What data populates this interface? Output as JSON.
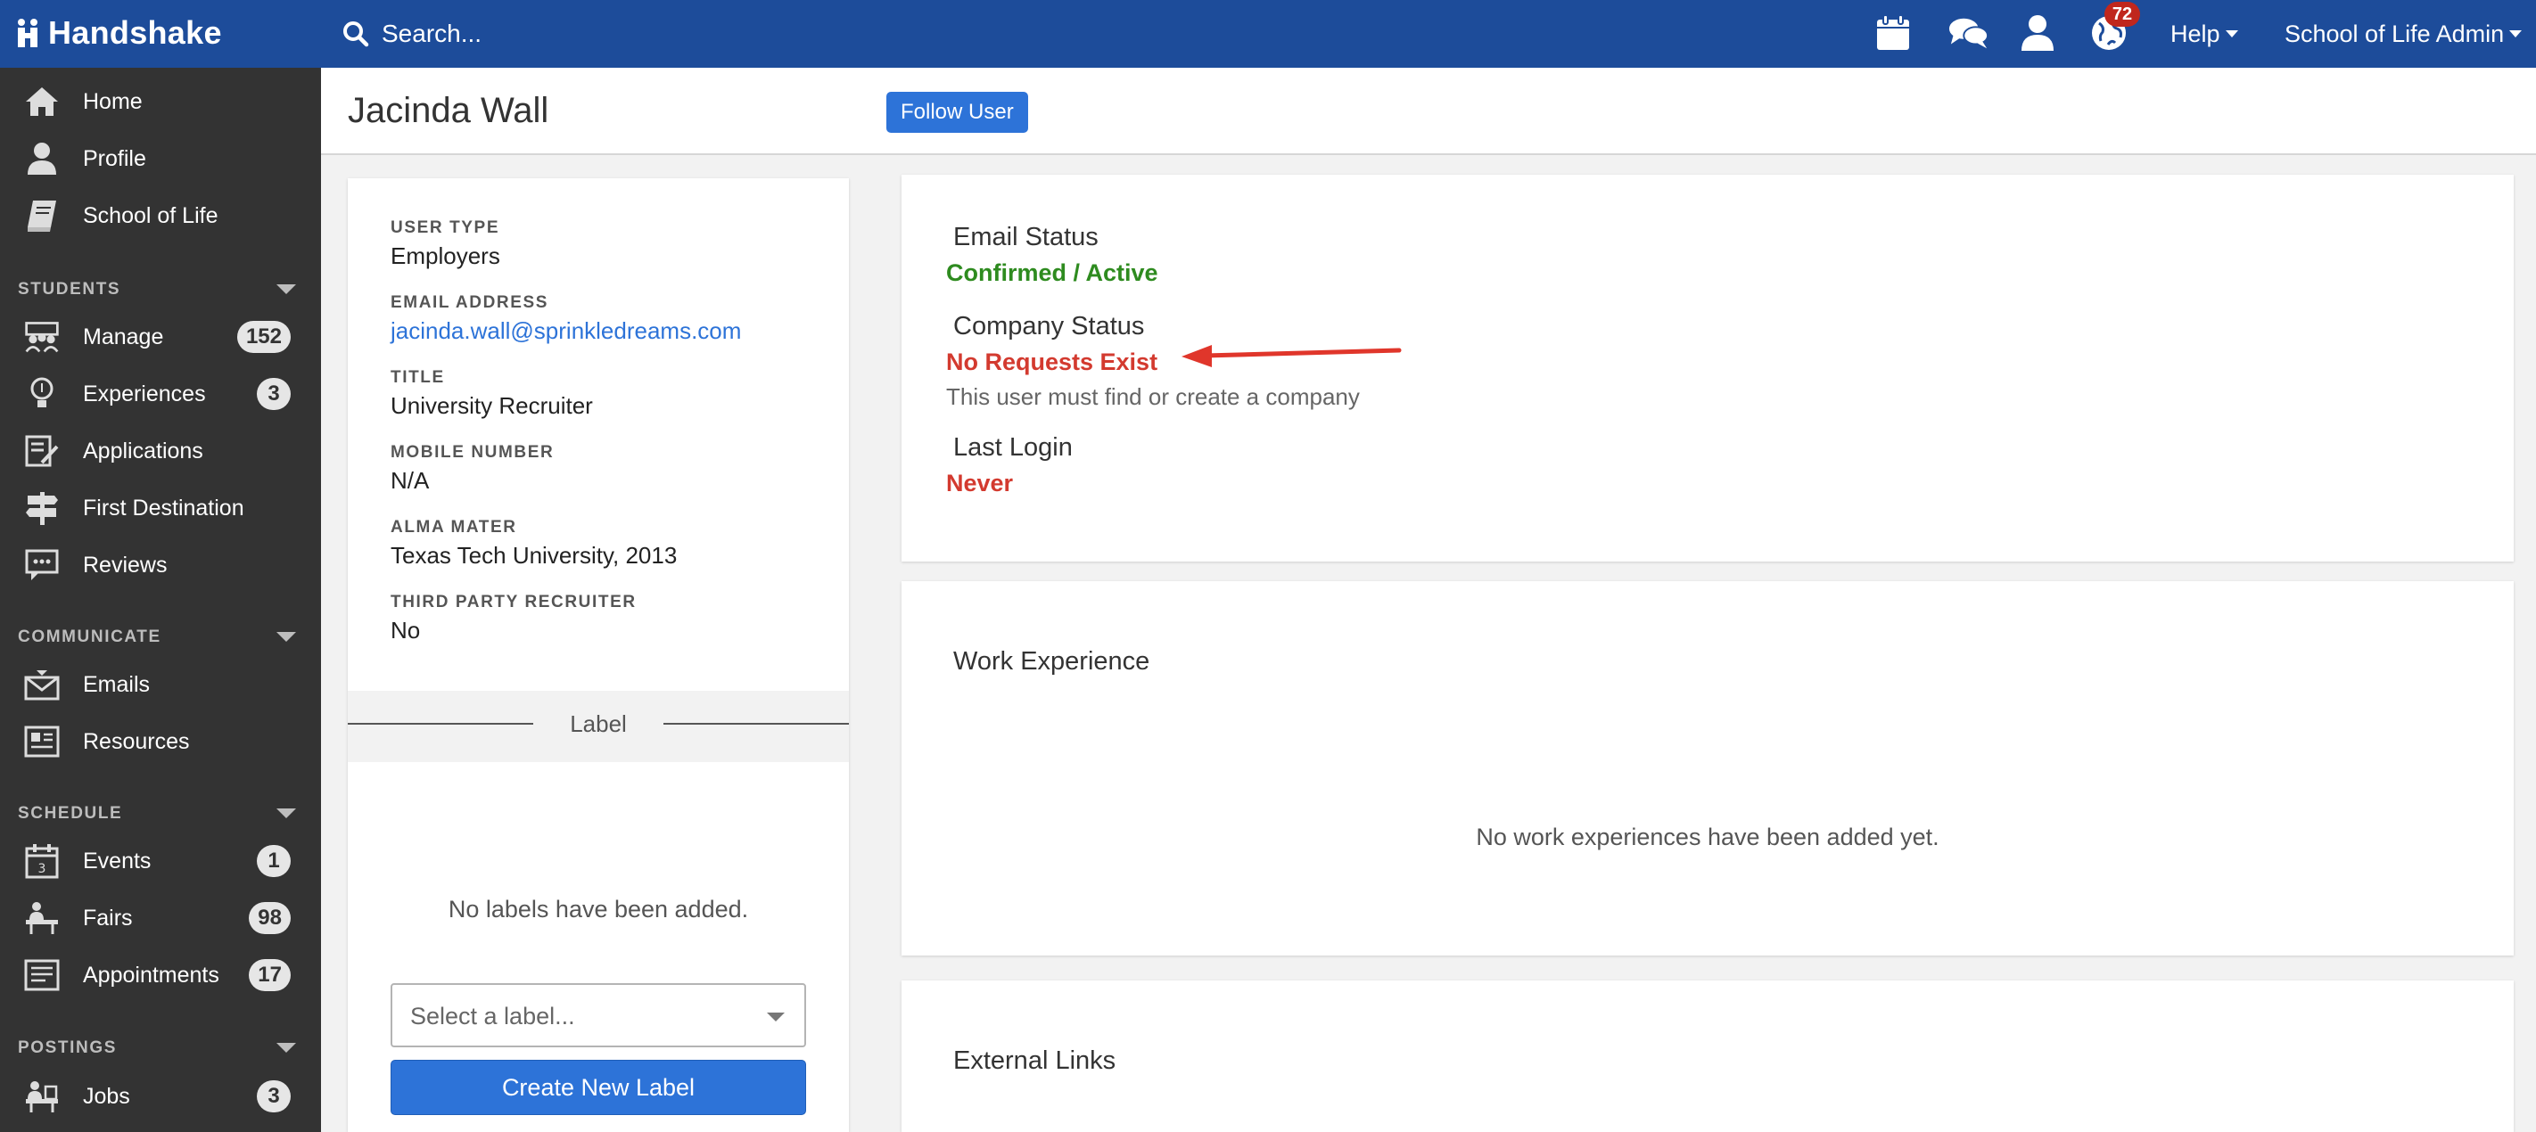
{
  "app": {
    "brand": "Handshake",
    "search_placeholder": "Search...",
    "notifications_count": "72",
    "help_label": "Help",
    "account_label": "School of Life Admin",
    "icons": [
      "search-icon",
      "calendar-icon",
      "chat-icon",
      "user-icon",
      "globe-icon"
    ]
  },
  "sidebar": {
    "top_items": [
      {
        "label": "Home",
        "icon": "home-icon"
      },
      {
        "label": "Profile",
        "icon": "profile-icon"
      },
      {
        "label": "School of Life",
        "icon": "book-icon"
      }
    ],
    "students": {
      "title": "STUDENTS",
      "items": [
        {
          "label": "Manage",
          "count": "152",
          "icon": "students-manage-icon"
        },
        {
          "label": "Experiences",
          "count": "3",
          "icon": "lightbulb-icon"
        },
        {
          "label": "Applications",
          "count": "",
          "icon": "applications-icon"
        },
        {
          "label": "First Destination",
          "count": "",
          "icon": "signpost-icon"
        },
        {
          "label": "Reviews",
          "count": "",
          "icon": "reviews-icon"
        }
      ]
    },
    "communicate": {
      "title": "COMMUNICATE",
      "items": [
        {
          "label": "Emails",
          "icon": "email-icon"
        },
        {
          "label": "Resources",
          "icon": "resources-icon"
        }
      ]
    },
    "schedule": {
      "title": "SCHEDULE",
      "items": [
        {
          "label": "Events",
          "count": "1",
          "icon": "events-calendar-icon"
        },
        {
          "label": "Fairs",
          "count": "98",
          "icon": "fairs-icon"
        },
        {
          "label": "Appointments",
          "count": "17",
          "icon": "appointments-icon"
        }
      ]
    },
    "postings": {
      "title": "POSTINGS",
      "items": [
        {
          "label": "Jobs",
          "count": "3",
          "icon": "jobs-icon"
        }
      ]
    }
  },
  "header": {
    "name": "Jacinda Wall",
    "follow_label": "Follow User"
  },
  "profile": {
    "fields": [
      {
        "label": "USER TYPE",
        "value": "Employers"
      },
      {
        "label": "EMAIL ADDRESS",
        "value": "jacinda.wall@sprinkledreams.com"
      },
      {
        "label": "TITLE",
        "value": "University Recruiter"
      },
      {
        "label": "MOBILE NUMBER",
        "value": "N/A"
      },
      {
        "label": "ALMA MATER",
        "value": "Texas Tech University, 2013"
      },
      {
        "label": "THIRD PARTY RECRUITER",
        "value": "No"
      }
    ],
    "labels_heading": "Label",
    "labels_empty": "No labels have been added.",
    "select_placeholder": "Select a label...",
    "create_label": "Create New Label"
  },
  "status": {
    "email_title": "Email Status",
    "email_value": "Confirmed / Active",
    "company_title": "Company Status",
    "company_value": "No Requests Exist",
    "company_note": "This user must find or create a company",
    "login_title": "Last Login",
    "login_value": "Never",
    "colors": {
      "ok": "#2e8b1f",
      "alert": "#d33a2f",
      "arrow": "#e0362b"
    }
  },
  "work": {
    "title": "Work Experience",
    "empty": "No work experiences have been added yet."
  },
  "links": {
    "title": "External Links"
  },
  "colors": {
    "topbar": "#1d4c9a",
    "sidebar": "#333333",
    "primary_button": "#2d73d8",
    "badge": "#c0271d"
  }
}
